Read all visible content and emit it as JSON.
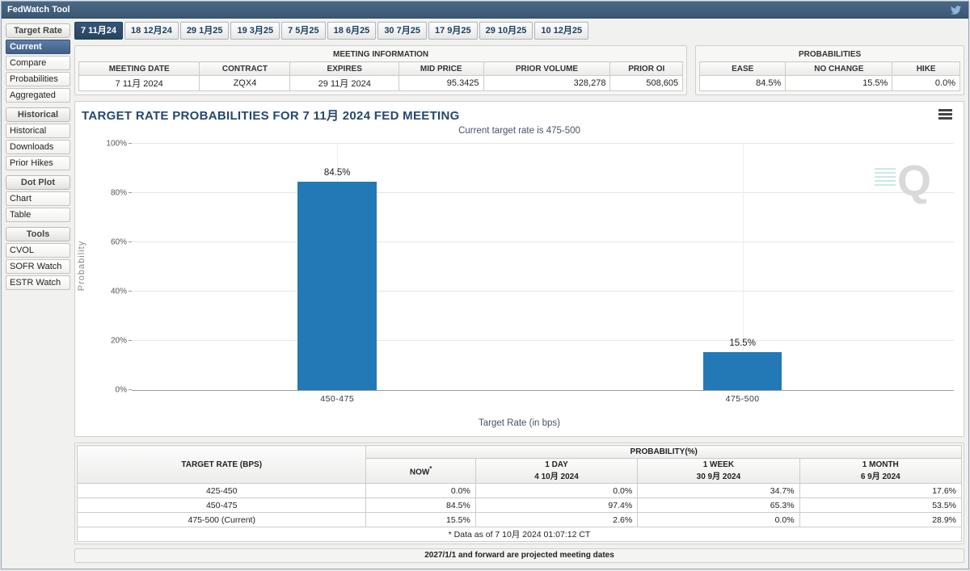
{
  "colors": {
    "header_bar": "#3e5c7a",
    "selected_navy": "#2d4a6b",
    "bar_blue": "#2279b5",
    "now_highlight": "#fafad2",
    "title_navy": "#25486e"
  },
  "header": {
    "title": "FedWatch Tool"
  },
  "sidebar": {
    "sections": [
      {
        "header": "Target Rate",
        "items": [
          {
            "label": "Current",
            "selected": true
          },
          {
            "label": "Compare",
            "selected": false
          },
          {
            "label": "Probabilities",
            "selected": false
          },
          {
            "label": "Aggregated",
            "selected": false
          }
        ]
      },
      {
        "header": "Historical",
        "items": [
          {
            "label": "Historical",
            "selected": false
          },
          {
            "label": "Downloads",
            "selected": false
          },
          {
            "label": "Prior Hikes",
            "selected": false
          }
        ]
      },
      {
        "header": "Dot Plot",
        "items": [
          {
            "label": "Chart",
            "selected": false
          },
          {
            "label": "Table",
            "selected": false
          }
        ]
      },
      {
        "header": "Tools",
        "items": [
          {
            "label": "CVOL",
            "selected": false
          },
          {
            "label": "SOFR Watch",
            "selected": false
          },
          {
            "label": "ESTR Watch",
            "selected": false
          }
        ]
      }
    ]
  },
  "tabs": {
    "selected_index": 0,
    "items": [
      {
        "label": "7 11月24"
      },
      {
        "label": "18 12月24"
      },
      {
        "label": "29 1月25"
      },
      {
        "label": "19 3月25"
      },
      {
        "label": "7 5月25"
      },
      {
        "label": "18 6月25"
      },
      {
        "label": "30 7月25"
      },
      {
        "label": "17 9月25"
      },
      {
        "label": "29 10月25"
      },
      {
        "label": "10 12月25"
      }
    ]
  },
  "meeting_information": {
    "title": "MEETING INFORMATION",
    "headers": [
      "MEETING DATE",
      "CONTRACT",
      "EXPIRES",
      "MID PRICE",
      "PRIOR VOLUME",
      "PRIOR OI"
    ],
    "values": [
      "7 11月 2024",
      "ZQX4",
      "29 11月 2024",
      "95.3425",
      "328,278",
      "508,605"
    ]
  },
  "probabilities_summary": {
    "title": "PROBABILITIES",
    "headers": [
      "EASE",
      "NO CHANGE",
      "HIKE"
    ],
    "values": [
      "84.5%",
      "15.5%",
      "0.0%"
    ]
  },
  "chart": {
    "title": "TARGET RATE PROBABILITIES FOR 7 11月 2024 FED MEETING",
    "subtitle": "Current target rate is 475-500",
    "watermark": "Q"
  },
  "chart_data": {
    "type": "bar",
    "categories": [
      "450-475",
      "475-500"
    ],
    "values": [
      84.5,
      15.5
    ],
    "value_labels": [
      "84.5%",
      "15.5%"
    ],
    "title": "TARGET RATE PROBABILITIES FOR 7 11月 2024 FED MEETING",
    "subtitle": "Current target rate is 475-500",
    "xlabel": "Target Rate (in bps)",
    "ylabel": "Probability",
    "ylim": [
      0,
      100
    ],
    "yticks": [
      "0%",
      "20%",
      "40%",
      "60%",
      "80%",
      "100%"
    ],
    "grid": true,
    "legend": false,
    "bar_color": "#2279b5",
    "bar_centers_pct": [
      25.0,
      74.3
    ]
  },
  "probability_table": {
    "row_header": "TARGET RATE (BPS)",
    "group_header": "PROBABILITY(%)",
    "columns": [
      {
        "label": "NOW",
        "sup": "*",
        "date": ""
      },
      {
        "label": "1 DAY",
        "date": "4 10月 2024"
      },
      {
        "label": "1 WEEK",
        "date": "30 9月 2024"
      },
      {
        "label": "1 MONTH",
        "date": "6 9月 2024"
      }
    ],
    "rows": [
      {
        "target": "425-450",
        "now": "0.0%",
        "day": "0.0%",
        "week": "34.7%",
        "month": "17.6%"
      },
      {
        "target": "450-475",
        "now": "84.5%",
        "day": "97.4%",
        "week": "65.3%",
        "month": "53.5%"
      },
      {
        "target": "475-500 (Current)",
        "now": "15.5%",
        "day": "2.6%",
        "week": "0.0%",
        "month": "28.9%"
      }
    ],
    "footnote": "* Data as of 7 10月 2024 01:07:12 CT"
  },
  "footer": {
    "note": "2027/1/1 and forward are projected meeting dates"
  }
}
